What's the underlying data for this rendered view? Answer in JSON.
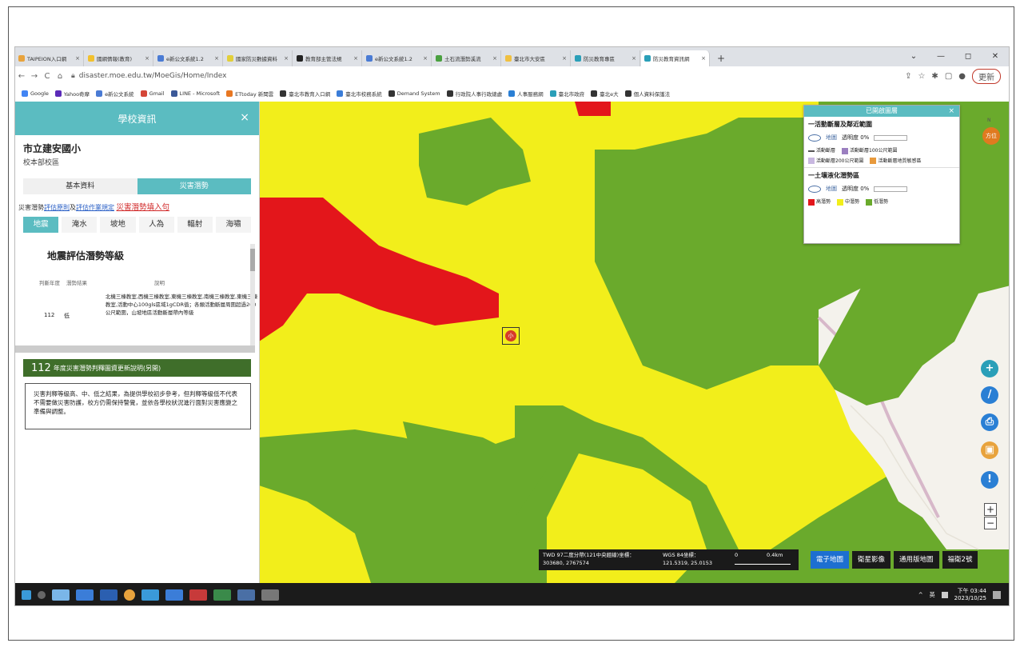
{
  "browser": {
    "tabs": [
      {
        "label": "TAIPEION入口網",
        "color": "#e8a33d"
      },
      {
        "label": "國網情報(教育)",
        "color": "#f2c12e"
      },
      {
        "label": "e新公文系統1.2",
        "color": "#4a7bd4"
      },
      {
        "label": "國家防災數據資料",
        "color": "#e2cf3a"
      },
      {
        "label": "教育部主管法規",
        "color": "#222222"
      },
      {
        "label": "e新公文系統1.2",
        "color": "#4a7bd4"
      },
      {
        "label": "土石流潛勢溪流",
        "color": "#4aa040"
      },
      {
        "label": "臺北市大安區",
        "color": "#f0c040"
      },
      {
        "label": "防災教育專區",
        "color": "#2a9fb8"
      },
      {
        "label": "防災教育資訊網",
        "color": "#2a9fb8"
      }
    ],
    "new_tab": "+",
    "window_controls": [
      "⌄",
      "—",
      "◻",
      "✕"
    ],
    "url": "disaster.moe.edu.tw/MoeGis/Home/Index",
    "update_label": "更新",
    "bookmarks": [
      {
        "label": "Google",
        "color": "#4285f4"
      },
      {
        "label": "Yahoo奇摩",
        "color": "#5b2bb8"
      },
      {
        "label": "e新公文系統",
        "color": "#4a7bd4"
      },
      {
        "label": "Gmail",
        "color": "#d44638"
      },
      {
        "label": "LINE - Microsoft",
        "color": "#3b5998"
      },
      {
        "label": "ETtoday 新聞雲",
        "color": "#e87722"
      },
      {
        "label": "臺北市教育入口網",
        "color": "#333333"
      },
      {
        "label": "臺北市校務系統",
        "color": "#3b7dd8"
      },
      {
        "label": "Demand System",
        "color": "#333333"
      },
      {
        "label": "行政院人事行政總處",
        "color": "#333333"
      },
      {
        "label": "人事服務網",
        "color": "#2a7fd4"
      },
      {
        "label": "臺北市政府",
        "color": "#2a9fb8"
      },
      {
        "label": "臺北e大",
        "color": "#333333"
      },
      {
        "label": "個人資料保護法",
        "color": "#333333"
      }
    ]
  },
  "school_panel": {
    "title": "學校資訊",
    "close": "×",
    "school_name": "市立建安國小",
    "campus": "校本部校區",
    "tab_basic": "基本資料",
    "tab_hazard": "災害潛勢",
    "link_prefix": "災害潛勢",
    "link_eval": "評估原則",
    "link_and": "及",
    "link_ops": "評估作業規定",
    "link_report": "災害潛勢填入句",
    "hazard_tabs": [
      "地震",
      "淹水",
      "坡地",
      "人為",
      "輻射",
      "海嘯"
    ],
    "section_title": "地震評估潛勢等級",
    "col_year": "判斷年度",
    "col_level": "潛勢結果",
    "col_desc": "說明",
    "row": {
      "year": "112",
      "level": "低",
      "desc": "北機三棟教室,西機三棟教室,東機三棟教室,南機三棟教室,東機三棟教室,活動中心100gls區域1gCDR值；各類活動斷層周圍超過200公尺範圍，山坡地區活動斷層帶內等級"
    },
    "notice_year": "112",
    "notice_text": "年度災害潛勢判釋圖資更新說明(另開)",
    "note": "災害判釋等級高、中、低之結果，為提供學校初步參考，但判釋等級低不代表不需要做災害防護，校方仍需保持警覺，並依各學校狀況進行面對災害應變之準備與調整。"
  },
  "layers_panel": {
    "title": "已開啟圖層",
    "close": "×",
    "sec1_title": "一活動斷層及鄰近範圍",
    "sec1_label": "地圖",
    "sec1_opacity": "透明度 0%",
    "sec1_legend": [
      {
        "label": "活動斷層",
        "color": "#555555"
      },
      {
        "label": "活動斷層100公尺範圍",
        "color": "#9b7fc0"
      },
      {
        "label": "活動斷層200公尺範圍",
        "color": "#c8b8e0"
      },
      {
        "label": "活動斷層地質敏感區",
        "color": "#e89a3c"
      }
    ],
    "sec2_title": "一土壤液化潛勢區",
    "sec2_label": "地圖",
    "sec2_opacity": "透明度 0%",
    "sec2_legend": [
      {
        "label": "高潛勢",
        "color": "#e3161b"
      },
      {
        "label": "中潛勢",
        "color": "#f2ee1b"
      },
      {
        "label": "低潛勢",
        "color": "#6aaa2c"
      }
    ]
  },
  "map": {
    "compass_label": "N",
    "compass_text": "方位",
    "school_marker": "小",
    "tools": [
      "+",
      "/",
      "⎙",
      "▣",
      "!"
    ],
    "zoom_in": "+",
    "zoom_out": "−",
    "coord_twd_label": "TWD 97二度分帶(121中央經線)坐標：",
    "coord_twd_value": "303680, 2767574",
    "coord_wgs_label": "WGS 84坐標：",
    "coord_wgs_value": "121.5319, 25.0153",
    "scale_zero": "0",
    "scale_label": "0.4km",
    "map_types": [
      "電子地圖",
      "衛星影像",
      "通用版地圖",
      "福衛2號"
    ],
    "active_map_type": "電子地圖"
  },
  "taskbar": {
    "lang": "英",
    "time": "下午 03:44",
    "date": "2023/10/25"
  }
}
